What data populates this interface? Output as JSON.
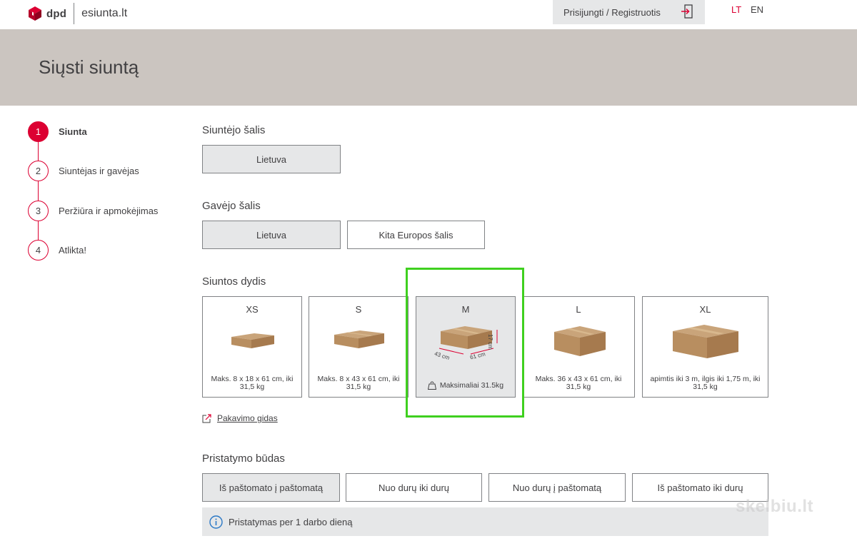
{
  "header": {
    "brand": "dpd",
    "site": "esiunta.lt",
    "login_label": "Prisijungti / Registruotis",
    "lang_lt": "LT",
    "lang_en": "EN",
    "accent_color": "#dc0032"
  },
  "page_title": "Siųsti siuntą",
  "steps": [
    {
      "num": "1",
      "label": "Siunta"
    },
    {
      "num": "2",
      "label": "Siuntėjas ir gavėjas"
    },
    {
      "num": "3",
      "label": "Peržiūra ir apmokėjimas"
    },
    {
      "num": "4",
      "label": "Atlikta!"
    }
  ],
  "sender_country": {
    "title": "Siuntėjo šalis",
    "options": [
      "Lietuva"
    ]
  },
  "receiver_country": {
    "title": "Gavėjo šalis",
    "options": [
      "Lietuva",
      "Kita Europos šalis"
    ]
  },
  "parcel_size": {
    "title": "Siuntos dydis",
    "cards": [
      {
        "size": "XS",
        "desc": "Maks. 8 x 18 x 61 cm, iki 31,5 kg"
      },
      {
        "size": "S",
        "desc": "Maks. 8 x 43 x 61 cm, iki 31,5 kg"
      },
      {
        "size": "M",
        "desc": "Maksimaliai 31.5kg",
        "dim_w": "43 cm",
        "dim_l": "61 cm",
        "dim_h": "17 cm"
      },
      {
        "size": "L",
        "desc": "Maks. 36 x 43 x 61 cm, iki 31,5 kg"
      },
      {
        "size": "XL",
        "desc": "apimtis iki 3 m, ilgis iki 1,75 m, iki 31,5 kg"
      }
    ],
    "guide_label": "Pakavimo gidas"
  },
  "delivery": {
    "title": "Pristatymo būdas",
    "options": [
      "Iš paštomato į paštomatą",
      "Nuo durų iki durų",
      "Nuo durų į paštomatą",
      "Iš paštomato iki durų"
    ],
    "info": "Pristatymas per 1 darbo dieną"
  },
  "watermark": "skelbiu.lt"
}
